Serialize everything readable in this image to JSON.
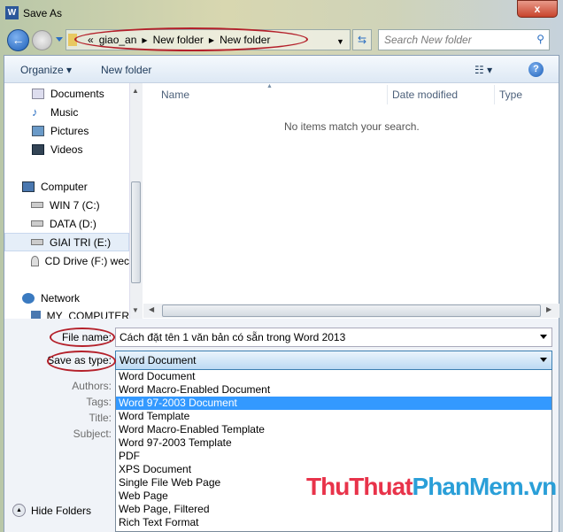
{
  "window": {
    "title": "Save As",
    "close": "x",
    "app_icon": "W"
  },
  "address": {
    "prefix": "«",
    "crumbs": [
      "giao_an",
      "New folder",
      "New folder"
    ],
    "search_placeholder": "Search New folder"
  },
  "toolbar": {
    "organize": "Organize ▾",
    "new_folder": "New folder",
    "view": "☷ ▾",
    "help": "?"
  },
  "nav": [
    {
      "label": "Documents",
      "icon": "documents-icon"
    },
    {
      "label": "Music",
      "icon": "music-icon"
    },
    {
      "label": "Pictures",
      "icon": "pictures-icon"
    },
    {
      "label": "Videos",
      "icon": "videos-icon"
    },
    {
      "label": "Computer",
      "icon": "computer-icon"
    },
    {
      "label": "WIN 7 (C:)",
      "icon": "drive-icon"
    },
    {
      "label": "DATA (D:)",
      "icon": "drive-icon"
    },
    {
      "label": "GIAI TRI (E:)",
      "icon": "drive-icon",
      "selected": true
    },
    {
      "label": "CD Drive (F:) wec",
      "icon": "cd-drive-icon"
    },
    {
      "label": "Network",
      "icon": "network-icon"
    },
    {
      "label": "MY_COMPUTER",
      "icon": "computer-icon"
    }
  ],
  "columns": [
    "Name",
    "Date modified",
    "Type"
  ],
  "empty_message": "No items match your search.",
  "form": {
    "file_name_label": "File name:",
    "file_name": "Cách đặt tên 1 văn bản có sẵn trong Word 2013",
    "type_label": "Save as type:",
    "type_value": "Word Document",
    "authors": "Authors:",
    "tags": "Tags:",
    "title": "Title:",
    "subject": "Subject:"
  },
  "type_options": [
    "Word Document",
    "Word Macro-Enabled Document",
    "Word 97-2003 Document",
    "Word Template",
    "Word Macro-Enabled Template",
    "Word 97-2003 Template",
    "PDF",
    "XPS Document",
    "Single File Web Page",
    "Web Page",
    "Web Page, Filtered",
    "Rich Text Format"
  ],
  "highlighted_option": 2,
  "hide_folders": "Hide Folders",
  "watermark": {
    "part1": "ThuThuat",
    "part2": "PhanMem",
    "part3": ".vn"
  },
  "colors": {
    "highlight": "#3399ff",
    "annotation": "#b4202a",
    "wm1": "#e8334a",
    "wm2": "#2a9fd8"
  }
}
